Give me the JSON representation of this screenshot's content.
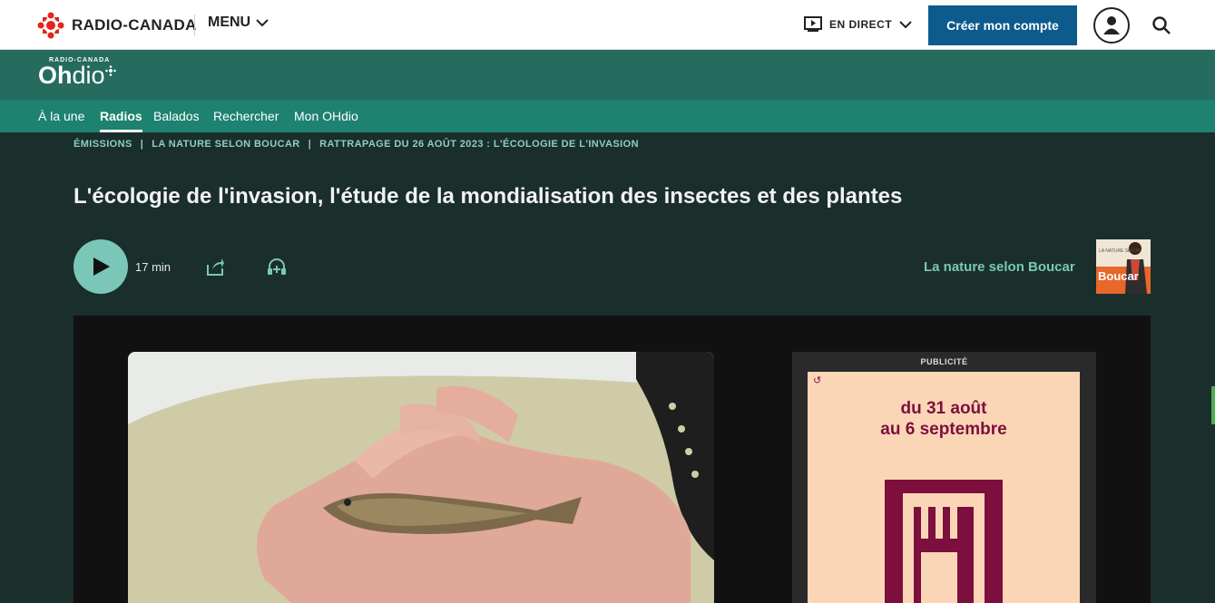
{
  "header": {
    "brand": "RADIO-CANADA",
    "menu_label": "MENU",
    "live_label": "EN DIRECT",
    "create_account": "Créer mon compte"
  },
  "ohdio": {
    "brand_small": "RADIO-CANADA",
    "brand_big_bold": "Oh",
    "brand_big_light": "dio"
  },
  "nav": {
    "items": [
      {
        "label": "À la une"
      },
      {
        "label": "Radios",
        "active": true
      },
      {
        "label": "Balados"
      },
      {
        "label": "Rechercher"
      },
      {
        "label": "Mon OHdio"
      }
    ]
  },
  "breadcrumb": {
    "items": [
      "ÉMISSIONS",
      "LA NATURE SELON BOUCAR",
      "RATTRAPAGE DU 26 AOÛT 2023 : L'ÉCOLOGIE DE L'INVASION"
    ],
    "separator": "|"
  },
  "episode": {
    "title": "L'écologie de l'invasion, l'étude de la mondialisation des insectes et des plantes",
    "duration": "17 min",
    "show_name": "La nature selon Boucar",
    "thumb_small": "LA NATURE SELON",
    "thumb_big": "Boucar"
  },
  "ad": {
    "label": "PUBLICITÉ",
    "line1": "du 31 août",
    "line2": "au 6 septembre"
  },
  "colors": {
    "cbc_red": "#e1261c",
    "button_blue": "#0c5b8c",
    "ohdio_green": "#256b5e",
    "nav_green": "#1d8270",
    "accent_teal": "#7ac7b7",
    "ad_maroon": "#7d0f3e"
  }
}
